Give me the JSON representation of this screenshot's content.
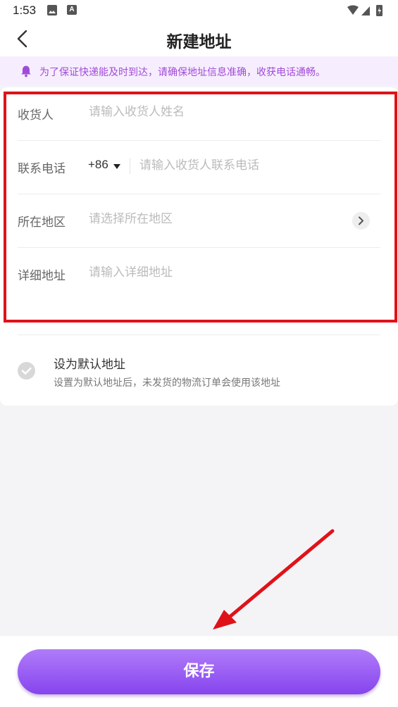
{
  "status_bar": {
    "time": "1:53",
    "notification_icons": [
      "image-icon",
      "a-letter-icon"
    ],
    "system_icons": [
      "wifi-icon",
      "cellular-signal-icon",
      "battery-charging-icon"
    ],
    "a_letter": "A"
  },
  "header": {
    "back_icon": "chevron-left-icon",
    "title": "新建地址"
  },
  "notice": {
    "icon": "bell-icon",
    "text": "为了保证快递能及时到达，请确保地址信息准确，收获电话通畅。",
    "color": "#a24ad8"
  },
  "form": {
    "recipient": {
      "label": "收货人",
      "placeholder": "请输入收货人姓名"
    },
    "phone": {
      "label": "联系电话",
      "country_code": "+86",
      "placeholder": "请输入收货人联系电话"
    },
    "region": {
      "label": "所在地区",
      "placeholder": "请选择所在地区"
    },
    "detail": {
      "label": "详细地址",
      "placeholder": "请输入详细地址"
    }
  },
  "default_address": {
    "title": "设为默认地址",
    "description": "设置为默认地址后，未发货的物流订单会使用该地址",
    "checked": false
  },
  "save_button": {
    "label": "保存",
    "gradient": [
      "#b07cf9",
      "#8644ee"
    ]
  },
  "annotation": {
    "highlight_color": "#e01219"
  }
}
